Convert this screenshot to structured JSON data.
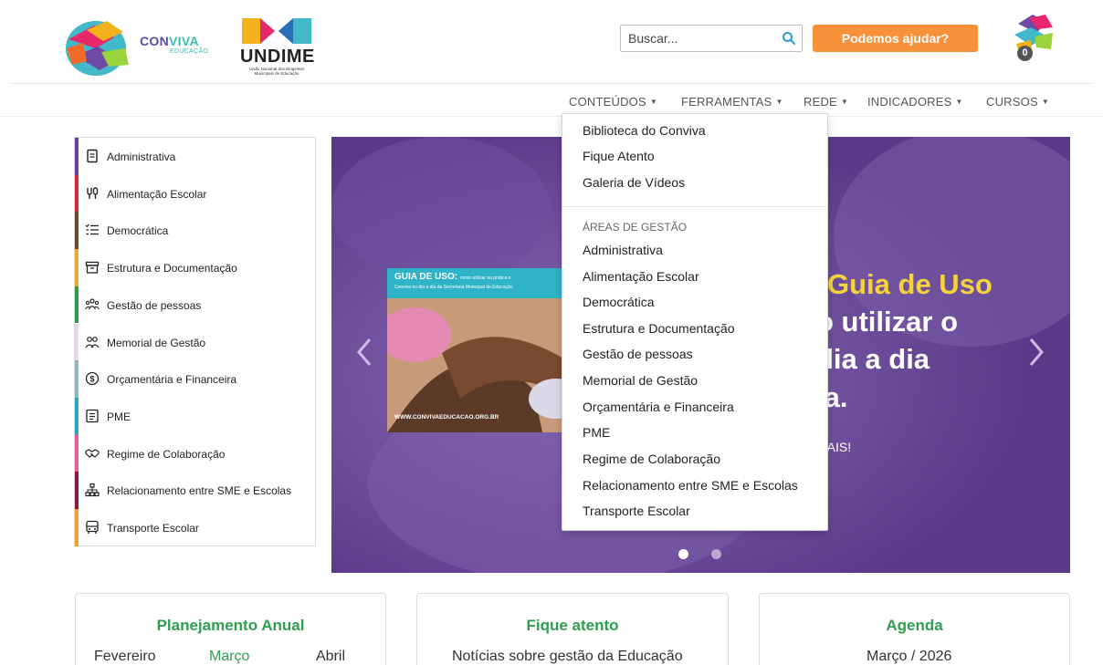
{
  "header": {
    "conviva_name_1": "CON",
    "conviva_name_2": "VIVA",
    "conviva_sub": "EDUCAÇÃO",
    "undime_name": "UNDIME",
    "undime_sub": "União Nacional dos Dirigentes Municipais de Educação",
    "search_placeholder": "Buscar...",
    "help_button": "Podemos ajudar?",
    "notification_count": "0"
  },
  "nav": {
    "items": [
      {
        "label": "CONTEÚDOS"
      },
      {
        "label": "FERRAMENTAS"
      },
      {
        "label": "REDE"
      },
      {
        "label": "INDICADORES"
      },
      {
        "label": "CURSOS"
      }
    ]
  },
  "sidebar": {
    "items": [
      {
        "label": "Administrativa",
        "color": "#6d3e9c",
        "icon": "document-icon"
      },
      {
        "label": "Alimentação Escolar",
        "color": "#d7263d",
        "icon": "cutlery-icon"
      },
      {
        "label": "Democrática",
        "color": "#6b4a2a",
        "icon": "checklist-icon"
      },
      {
        "label": "Estrutura e Documentação",
        "color": "#e8a93a",
        "icon": "archive-icon"
      },
      {
        "label": "Gestão de pessoas",
        "color": "#2e9c4e",
        "icon": "people-group-icon"
      },
      {
        "label": "Memorial de Gestão",
        "color": "#e8d9f0",
        "icon": "users-icon"
      },
      {
        "label": "Orçamentária e Financeira",
        "color": "#8fb8c8",
        "icon": "money-icon"
      },
      {
        "label": "PME",
        "color": "#2fa3c6",
        "icon": "plan-icon"
      },
      {
        "label": "Regime de Colaboração",
        "color": "#e85ca0",
        "icon": "handshake-icon"
      },
      {
        "label": "Relacionamento entre SME e Escolas",
        "color": "#8a1c3c",
        "icon": "sitemap-icon"
      },
      {
        "label": "Transporte Escolar",
        "color": "#f0a030",
        "icon": "bus-icon"
      }
    ]
  },
  "slider": {
    "card_title": "GUIA DE USO:",
    "card_title_rest": "como utilizar na prática o",
    "card_subtitle": "Conviva no dia a dia da Secretaria Municipal de Educação",
    "card_url": "WWW.CONVIVAEDUCACAO.ORG.BR",
    "line1": "Guia de Uso",
    "line2": "o utilizar o",
    "line3": "dia a dia",
    "line4": "ia.",
    "more": "MAIS!"
  },
  "dropdown": {
    "items": [
      "Biblioteca do Conviva",
      "Fique Atento",
      "Galeria de Vídeos"
    ],
    "section_header": "ÁREAS DE GESTÃO",
    "areas": [
      "Administrativa",
      "Alimentação Escolar",
      "Democrática",
      "Estrutura e Documentação",
      "Gestão de pessoas",
      "Memorial de Gestão",
      "Orçamentária e Financeira",
      "PME",
      "Regime de Colaboração",
      "Relacionamento entre SME e Escolas",
      "Transporte Escolar"
    ]
  },
  "cards": {
    "planejamento": {
      "title": "Planejamento Anual",
      "prev_month": "Fevereiro",
      "current_month": "Março",
      "next_month": "Abril"
    },
    "fique_atento": {
      "title": "Fique atento",
      "text": "Notícias sobre gestão da Educação"
    },
    "agenda": {
      "title": "Agenda",
      "text": "Março / 2026"
    }
  },
  "colors": {
    "accent_orange": "#f7923a",
    "card_title_green": "#2f9e4f",
    "slider_purple": "#6a4a9a"
  }
}
